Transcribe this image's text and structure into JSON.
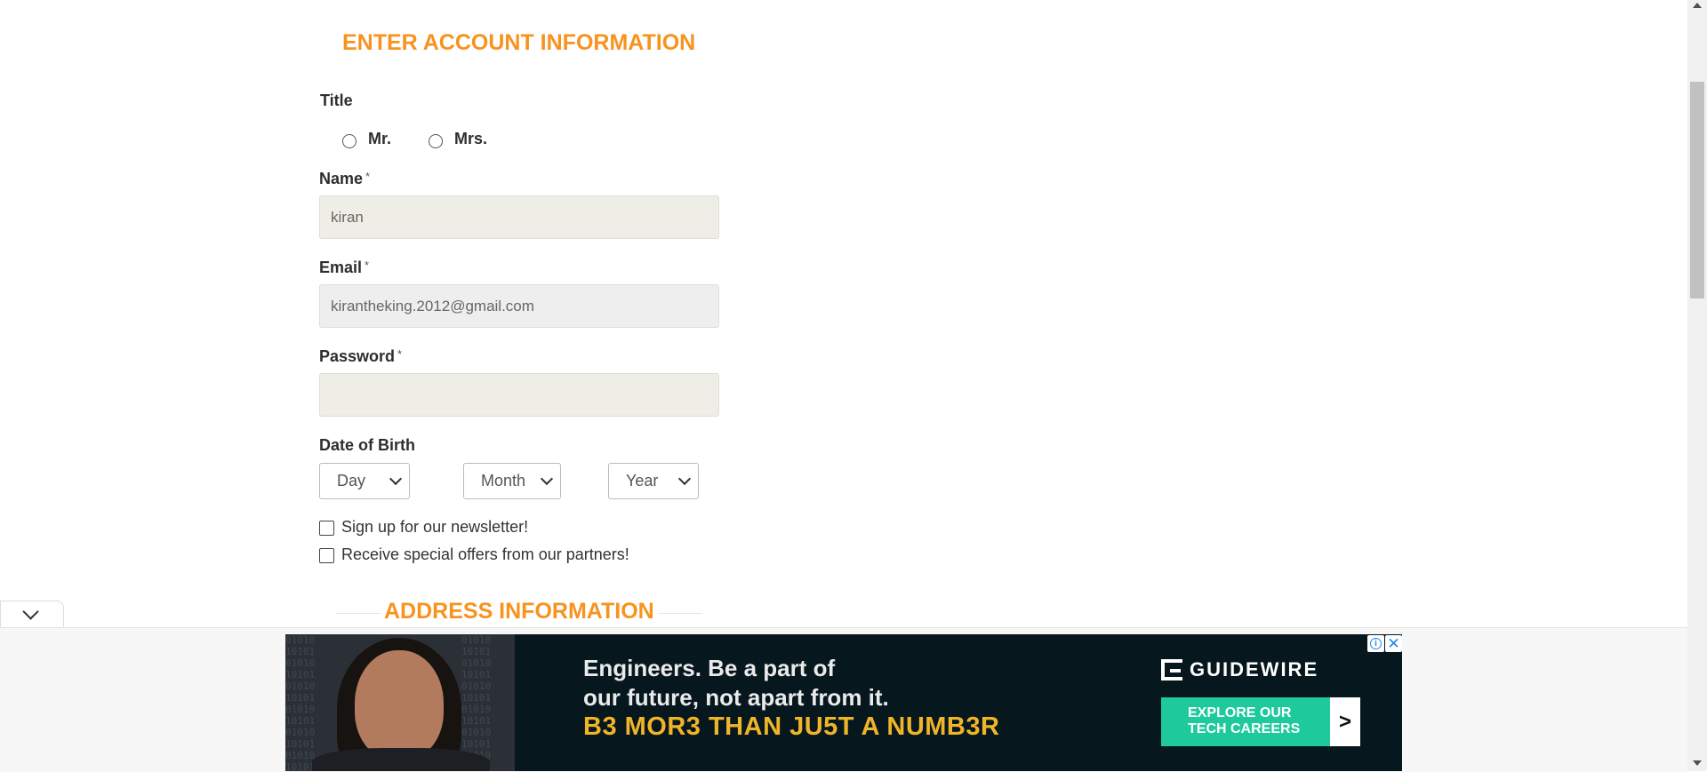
{
  "account_section": {
    "title": "ENTER ACCOUNT INFORMATION"
  },
  "title_field": {
    "label": "Title",
    "options": [
      {
        "label": "Mr.",
        "checked": false
      },
      {
        "label": "Mrs.",
        "checked": false
      }
    ]
  },
  "name_field": {
    "label": "Name",
    "required_mark": "*",
    "value": "kiran"
  },
  "email_field": {
    "label": "Email",
    "required_mark": "*",
    "value": "kirantheking.2012@gmail.com"
  },
  "password_field": {
    "label": "Password",
    "required_mark": "*",
    "value": ""
  },
  "dob": {
    "label": "Date of Birth",
    "day": "Day",
    "month": "Month",
    "year": "Year"
  },
  "checkboxes": [
    {
      "label": "Sign up for our newsletter!",
      "checked": false
    },
    {
      "label": "Receive special offers from our partners!",
      "checked": false
    }
  ],
  "address_section": {
    "title": "ADDRESS INFORMATION"
  },
  "ad": {
    "headline_line1": "Engineers. Be a part of",
    "headline_line2": "our future, not apart from it.",
    "tagline": "B3 MOR3 THAN JU5T A NUMB3R",
    "brand": "GUIDEWIRE",
    "cta_line1": "EXPLORE OUR",
    "cta_line2": "TECH CAREERS",
    "cta_arrow": ">",
    "info_glyph": "i",
    "close_glyph": "✕",
    "binary_pattern": "01010\n10101\n01010\n10101\n01010\n10101\n01010\n10101\n01010\n10101\n01010\n10101",
    "colors": {
      "background": "#06171e",
      "accent": "#f0b429",
      "cta": "#1ec99c"
    }
  },
  "theme": {
    "section_title_color": "#f7931e"
  }
}
